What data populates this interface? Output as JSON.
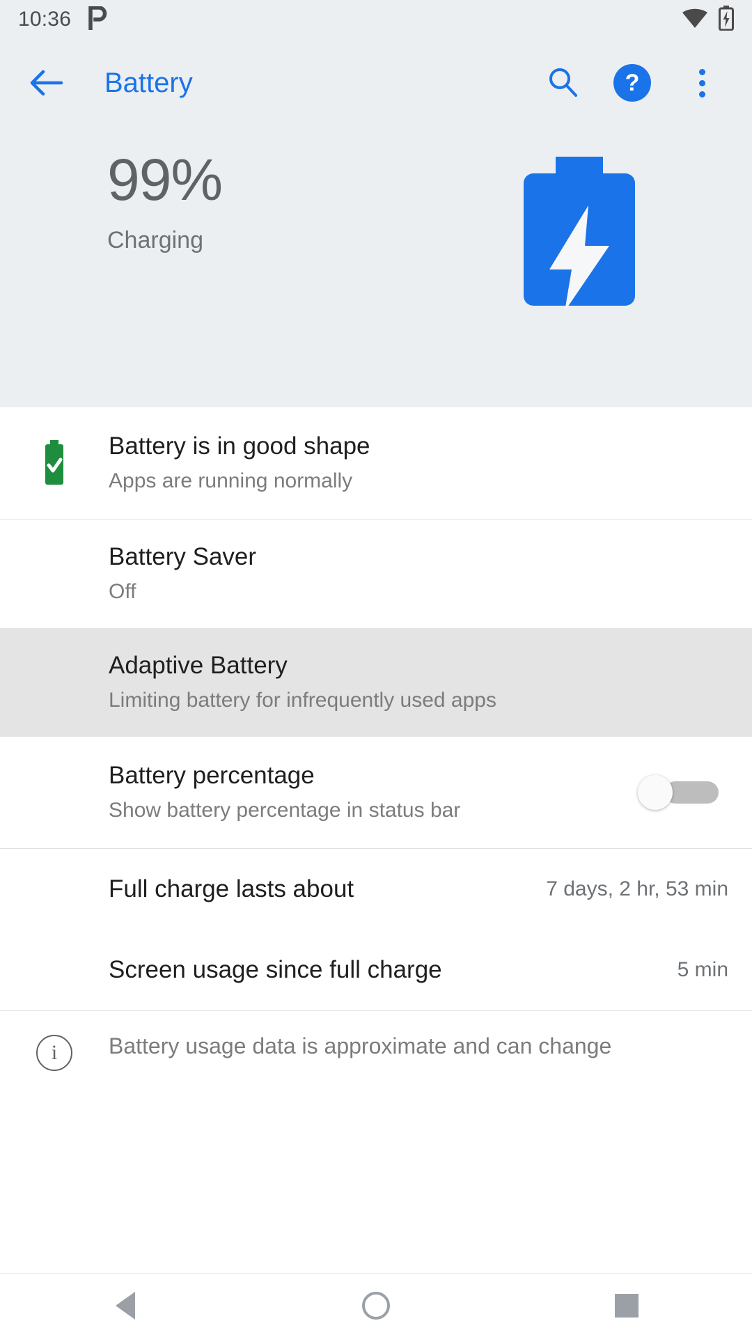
{
  "statusbar": {
    "time": "10:36",
    "left_icons": [
      "pocketcasts-icon"
    ],
    "right_icons": [
      "wifi-icon",
      "battery-charging-icon"
    ],
    "background": "#eceff1"
  },
  "appbar": {
    "back_label": "←",
    "title": "Battery",
    "title_color": "#1a73e8",
    "actions": [
      {
        "name": "search-icon",
        "label": ""
      },
      {
        "name": "help-icon",
        "label": "?"
      },
      {
        "name": "overflow-menu-icon",
        "label": ""
      }
    ]
  },
  "hero": {
    "percentage": "99%",
    "status": "Charging",
    "battery_icon": "battery-charging-large-icon",
    "battery_color": "#1a73e8",
    "bolt_color": "#ffffff",
    "background": "#eceff1"
  },
  "list": {
    "rows": [
      {
        "name": "battery-health-row",
        "icon": "battery-check-green-icon",
        "icon_color": "#1e8e3e",
        "title": "Battery is in good shape",
        "subtitle": "Apps are running normally",
        "highlighted": false
      },
      {
        "name": "battery-saver-row",
        "title": "Battery Saver",
        "subtitle": "Off",
        "highlighted": false
      },
      {
        "name": "adaptive-battery-row",
        "title": "Adaptive Battery",
        "subtitle": "Limiting battery for infrequently used apps",
        "highlighted": true,
        "highlight_color": "#e4e4e4"
      },
      {
        "name": "battery-percentage-row",
        "title": "Battery percentage",
        "subtitle": "Show battery percentage in status bar",
        "toggle": "off",
        "highlighted": false
      },
      {
        "name": "full-charge-lasts-row",
        "title": "Full charge lasts about",
        "value": "7 days, 2 hr, 53 min"
      },
      {
        "name": "screen-usage-row",
        "title": "Screen usage since full charge",
        "value": "5 min"
      }
    ],
    "footer": {
      "name": "battery-usage-disclaimer",
      "icon": "info-icon",
      "text": "Battery usage data is approximate and can change"
    }
  },
  "navbar": {
    "back": "back-nav-button",
    "home": "home-nav-button",
    "recents": "recents-nav-button"
  }
}
